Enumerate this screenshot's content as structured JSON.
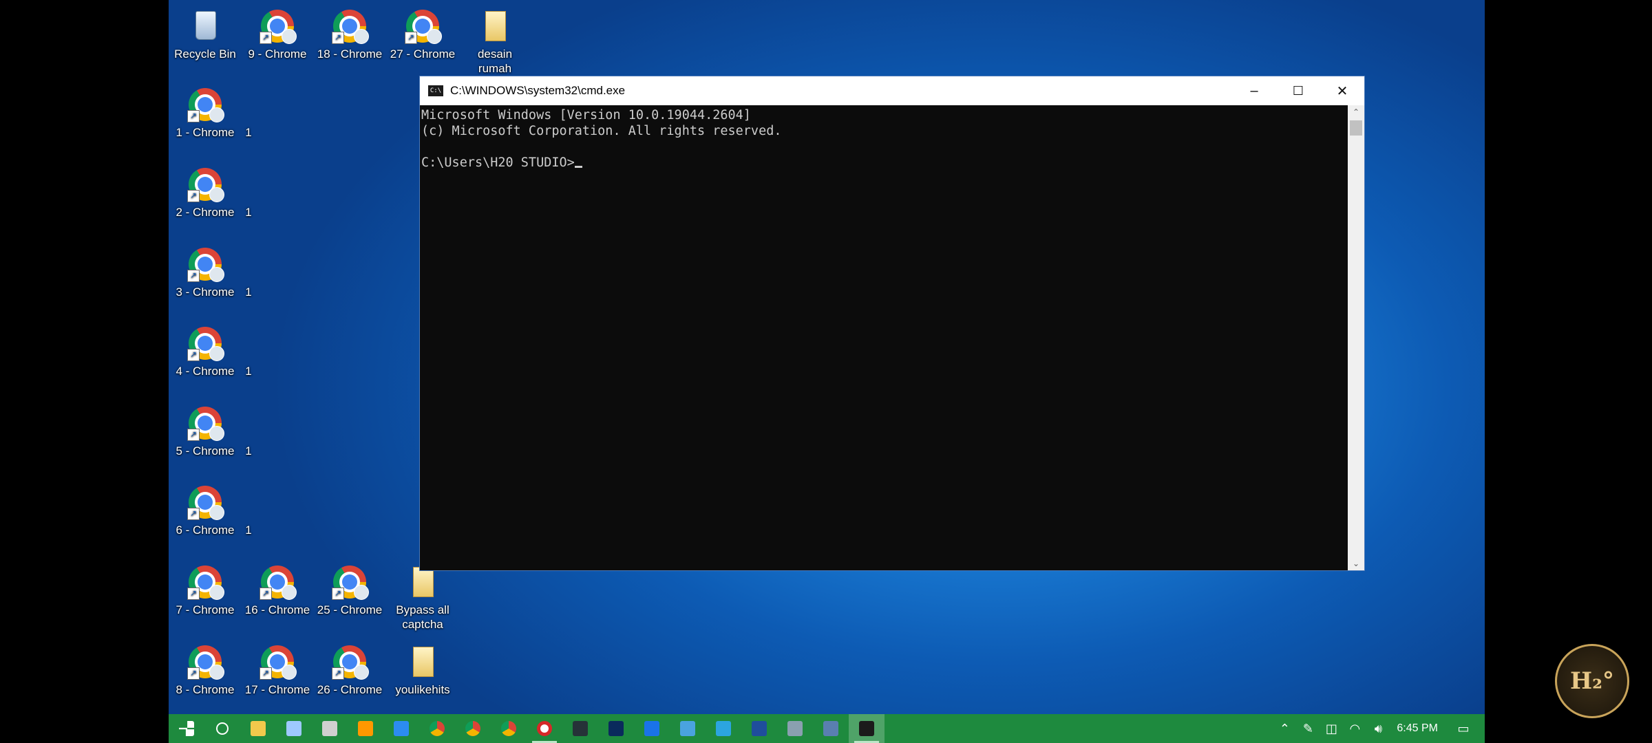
{
  "desktop_icons": [
    {
      "label": "Recycle Bin",
      "type": "bin",
      "col": 0,
      "row": 0
    },
    {
      "label": "9 - Chrome",
      "type": "chrome",
      "col": 1,
      "row": 0
    },
    {
      "label": "18 - Chrome",
      "type": "chrome",
      "col": 2,
      "row": 0
    },
    {
      "label": "27 - Chrome",
      "type": "chrome",
      "col": 3,
      "row": 0
    },
    {
      "label": "desain\nrumah",
      "type": "folder",
      "col": 4,
      "row": 0
    },
    {
      "label": "1 - Chrome",
      "type": "chrome",
      "col": 0,
      "row": 1
    },
    {
      "label": "2 - Chrome",
      "type": "chrome",
      "col": 0,
      "row": 2
    },
    {
      "label": "3 - Chrome",
      "type": "chrome",
      "col": 0,
      "row": 3
    },
    {
      "label": "4 - Chrome",
      "type": "chrome",
      "col": 0,
      "row": 4
    },
    {
      "label": "5 - Chrome",
      "type": "chrome",
      "col": 0,
      "row": 5
    },
    {
      "label": "6 - Chrome",
      "type": "chrome",
      "col": 0,
      "row": 6
    },
    {
      "label": "7 - Chrome",
      "type": "chrome",
      "col": 0,
      "row": 7
    },
    {
      "label": "16 - Chrome",
      "type": "chrome",
      "col": 1,
      "row": 7
    },
    {
      "label": "25 - Chrome",
      "type": "chrome",
      "col": 2,
      "row": 7
    },
    {
      "label": "Bypass all\ncaptcha",
      "type": "folder",
      "col": 3,
      "row": 7
    },
    {
      "label": "8 - Chrome",
      "type": "chrome",
      "col": 0,
      "row": 8
    },
    {
      "label": "17 - Chrome",
      "type": "chrome",
      "col": 1,
      "row": 8
    },
    {
      "label": "26 - Chrome",
      "type": "chrome",
      "col": 2,
      "row": 8
    },
    {
      "label": "youlikehits",
      "type": "folder",
      "col": 3,
      "row": 8
    }
  ],
  "partial_labels": [
    "1",
    "1",
    "1",
    "1",
    "1",
    "1"
  ],
  "cmd_window": {
    "title": "C:\\WINDOWS\\system32\\cmd.exe",
    "minimize": "–",
    "maximize": "☐",
    "close": "✕",
    "line1": "Microsoft Windows [Version 10.0.19044.2604]",
    "line2": "(c) Microsoft Corporation. All rights reserved.",
    "prompt": "C:\\Users\\H20 STUDIO>",
    "scroll_up": "⌃",
    "scroll_down": "⌄"
  },
  "taskbar": {
    "items": [
      {
        "name": "start-button",
        "color": "#ffffff"
      },
      {
        "name": "search-button",
        "color": "#ffffff"
      },
      {
        "name": "file-explorer",
        "color": "#f2c94c"
      },
      {
        "name": "app-cortana",
        "color": "#9ec9ff"
      },
      {
        "name": "app-2",
        "color": "#d0d0d0"
      },
      {
        "name": "sublime-text",
        "color": "#ff9800"
      },
      {
        "name": "vscode",
        "color": "#2c8cf0"
      },
      {
        "name": "chrome",
        "color": "#f4b400"
      },
      {
        "name": "chrome-2",
        "color": "#db4437"
      },
      {
        "name": "chrome-3",
        "color": "#e57c28"
      },
      {
        "name": "recorder",
        "color": "#d62828"
      },
      {
        "name": "app-dark",
        "color": "#263238"
      },
      {
        "name": "photoshop",
        "color": "#0a2a5c"
      },
      {
        "name": "teamviewer",
        "color": "#1a73e8"
      },
      {
        "name": "network-app",
        "color": "#4aa3df"
      },
      {
        "name": "telegram",
        "color": "#2ca5e0"
      },
      {
        "name": "powershell",
        "color": "#1f4e9c"
      },
      {
        "name": "app-tools",
        "color": "#8aa0b0"
      },
      {
        "name": "remote-desktop",
        "color": "#5a7fb0"
      },
      {
        "name": "cmd",
        "color": "#1b1b1b"
      }
    ],
    "clock": "6:45 PM"
  },
  "watermark": "H₂°"
}
